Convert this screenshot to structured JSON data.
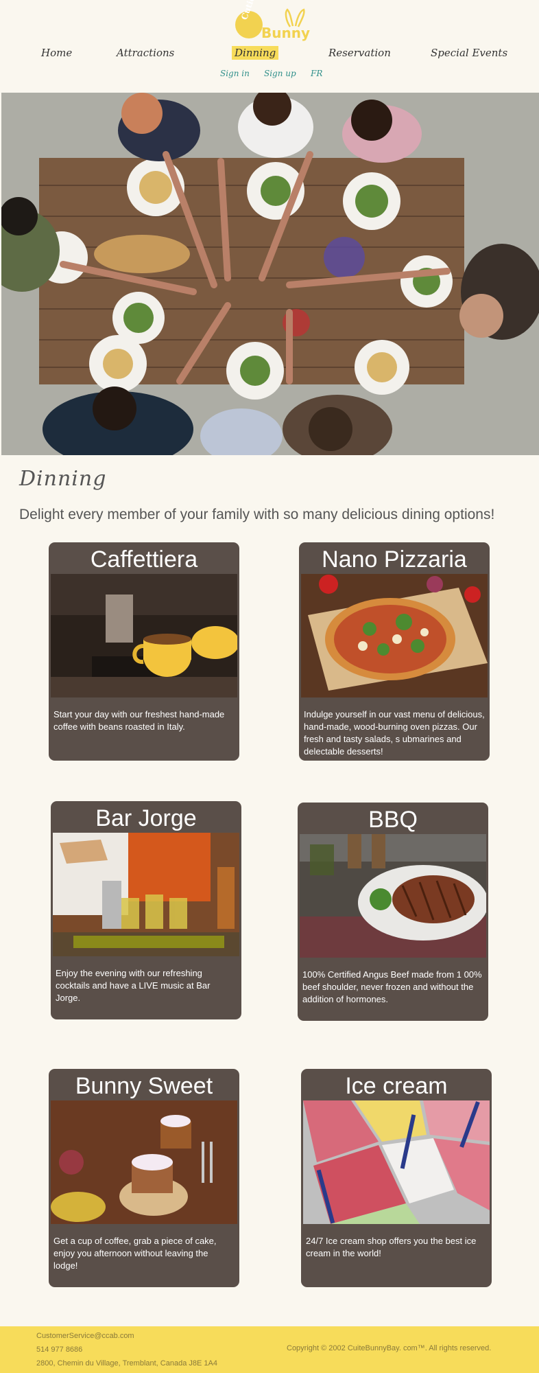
{
  "logo": {
    "top_text": "Cutie",
    "main_text": "Bunny"
  },
  "nav": {
    "items": [
      {
        "label": "Home",
        "active": false
      },
      {
        "label": "Attractions",
        "active": false
      },
      {
        "label": "Dinning",
        "active": true
      },
      {
        "label": "Reservation",
        "active": false
      },
      {
        "label": "Special Events",
        "active": false
      }
    ]
  },
  "subnav": {
    "signin": "Sign in",
    "signup": "Sign up",
    "lang": "FR"
  },
  "page": {
    "title": "Dinning",
    "subtitle": "Delight every member of your family with so many delicious dining options!"
  },
  "cards": [
    {
      "title": "Caffettiera",
      "desc": "Start your day with our freshest hand-made coffee with beans roasted in Italy."
    },
    {
      "title": "Nano Pizzaria",
      "desc": "Indulge yourself in our vast menu of delicious, hand-made, wood-burning oven pizzas. Our fresh and tasty salads, s ubmarines and delectable desserts!"
    },
    {
      "title": "Bar Jorge",
      "desc": "Enjoy the evening with our refreshing cocktails and have a LIVE music at Bar Jorge."
    },
    {
      "title": "BBQ",
      "desc": "100% Certified Angus Beef made from 1 00% beef shoulder, never frozen and without the addition of hormones."
    },
    {
      "title": "Bunny Sweet",
      "desc": "Get a cup of coffee, grab a piece of cake, enjoy you afternoon without leaving the lodge!"
    },
    {
      "title": "Ice cream",
      "desc": "24/7 Ice cream shop offers you the best ice cream in the world!"
    }
  ],
  "footer": {
    "email": "CustomerService@ccab.com",
    "phone": "514 977 8686",
    "address": "2800, Chemin du Village, Tremblant, Canada J8E 1A4",
    "copyright": "Copyright © 2002 CuiteBunnyBay. com™. All rights reserved."
  },
  "colors": {
    "accent": "#f7dc5a",
    "card_bg": "#5a4f49",
    "link": "#2f8f8a",
    "page_bg": "#faf7ef"
  }
}
